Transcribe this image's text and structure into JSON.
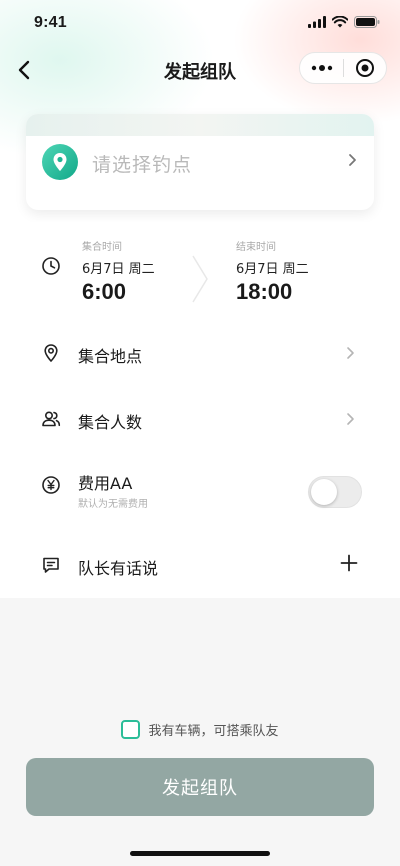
{
  "status_bar": {
    "time": "9:41"
  },
  "nav": {
    "title": "发起组队"
  },
  "spot_card": {
    "placeholder": "请选择钓点"
  },
  "time_range": {
    "start": {
      "caption": "集合时间",
      "date": "6月7日 周二",
      "time": "6:00"
    },
    "end": {
      "caption": "结束时间",
      "date": "6月7日 周二",
      "time": "18:00"
    }
  },
  "rows": {
    "place": {
      "label": "集合地点"
    },
    "people": {
      "label": "集合人数"
    },
    "fee": {
      "label": "费用AA",
      "sub": "默认为无需费用",
      "enabled": false
    },
    "leader": {
      "label": "队长有话说"
    }
  },
  "car_option": {
    "label": "我有车辆，可搭乘队友",
    "checked": false
  },
  "submit": {
    "label": "发起组队"
  },
  "colors": {
    "accent": "#2bbd98",
    "submit_bg": "#93a7a3"
  }
}
